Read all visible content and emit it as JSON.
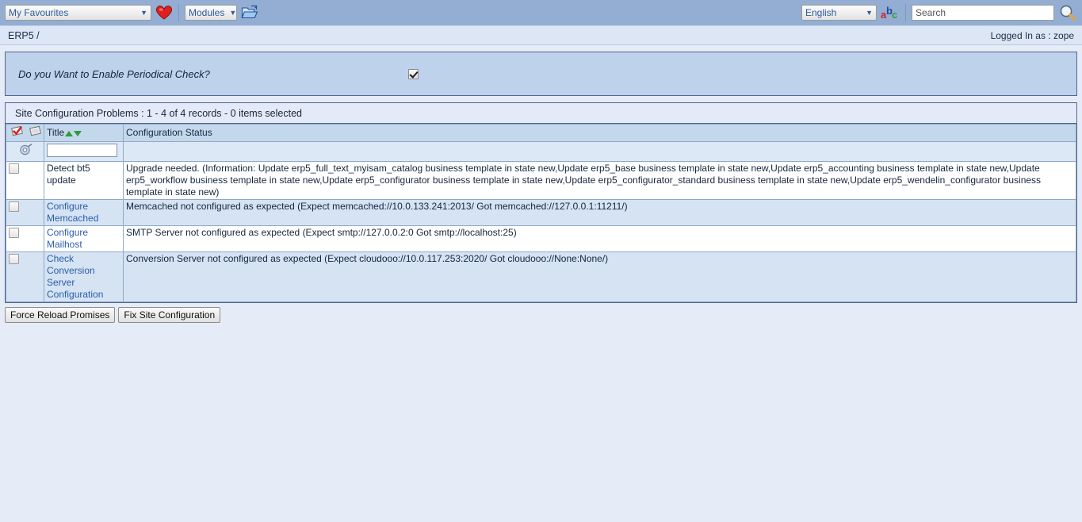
{
  "toolbar": {
    "favourites_selected": "My Favourites",
    "favourites_icon": "heart-icon",
    "modules_selected": "Modules",
    "modules_icon": "open-folder-icon",
    "language_selected": "English",
    "language_icon": "abc-translate-icon",
    "search_value": "",
    "search_placeholder": "Search",
    "search_icon": "magnifier-icon"
  },
  "breadcrumb": {
    "path": "ERP5 /",
    "login_status": "Logged In as : zope"
  },
  "periodical": {
    "question": "Do you Want to Enable Periodical Check?",
    "checked": true
  },
  "listbox": {
    "title": "Site Configuration Problems :  1 - 4 of 4 records - 0 items selected",
    "header_icons": [
      "stamp-check-icon",
      "stamp-blank-icon"
    ],
    "filter_icon": "filter-gear-icon",
    "filter_title_value": "",
    "columns": {
      "select": "",
      "title": "Title",
      "status": "Configuration Status"
    },
    "rows": [
      {
        "selected": false,
        "title": "Detect bt5 update",
        "title_is_link": false,
        "status": "Upgrade needed. (Information: Update erp5_full_text_myisam_catalog business template in state new,Update erp5_base business template in state new,Update erp5_accounting business template in state new,Update erp5_workflow business template in state new,Update erp5_configurator business template in state new,Update erp5_configurator_standard business template in state new,Update erp5_wendelin_configurator business template in state new)"
      },
      {
        "selected": false,
        "title": "Configure Memcached",
        "title_is_link": true,
        "status": "Memcached not configured as expected (Expect memcached://10.0.133.241:2013/ Got memcached://127.0.0.1:11211/)"
      },
      {
        "selected": false,
        "title": "Configure Mailhost",
        "title_is_link": true,
        "status": "SMTP Server not configured as expected (Expect smtp://127.0.0.2:0 Got smtp://localhost:25)"
      },
      {
        "selected": false,
        "title": "Check Conversion Server Configuration",
        "title_is_link": true,
        "status": "Conversion Server not configured as expected (Expect cloudooo://10.0.117.253:2020/ Got cloudooo://None:None/)"
      }
    ]
  },
  "actions": {
    "force_reload": "Force Reload Promises",
    "fix_site": "Fix Site Configuration"
  },
  "colors": {
    "toolbar_bg": "#93aed2",
    "panel_bg": "#bed2ec",
    "header_row_bg": "#c4d8ec",
    "row_alt_bg": "#d5e3f3",
    "link": "#2a5eab",
    "sort_arrow": "#2e9c3a"
  }
}
